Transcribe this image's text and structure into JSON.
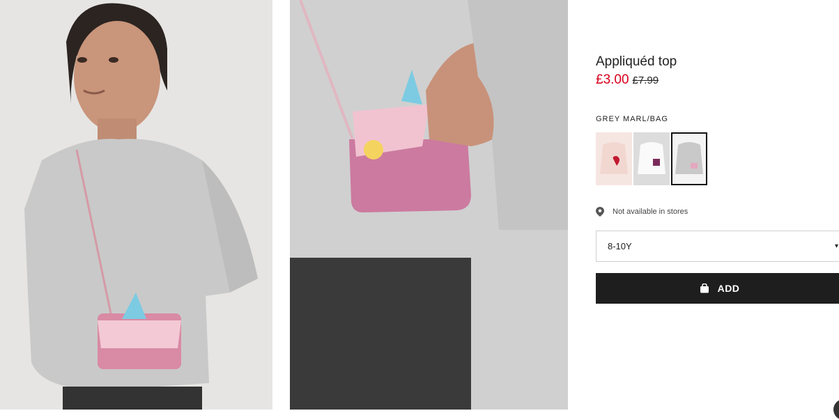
{
  "product": {
    "title": "Appliquéd top",
    "price_sale": "£3.00",
    "price_original": "£7.99",
    "color_label": "GREY MARL/BAG",
    "swatches": [
      {
        "name": "light pink",
        "color": "#f6e6e2",
        "selected": false
      },
      {
        "name": "white",
        "color": "#f7f7f7",
        "selected": false
      },
      {
        "name": "grey marl",
        "color": "#cfcfcf",
        "selected": true
      }
    ],
    "store_availability": "Not available in stores",
    "size": {
      "selected": "8-10Y"
    },
    "add_label": "ADD"
  },
  "icons": {
    "store": "location-pin-icon",
    "add": "shopping-bag-icon",
    "dropdown": "chevron-down-icon"
  },
  "colors": {
    "sale": "#d6001c",
    "button": "#1e1e1e",
    "border": "#d0d0d0"
  }
}
